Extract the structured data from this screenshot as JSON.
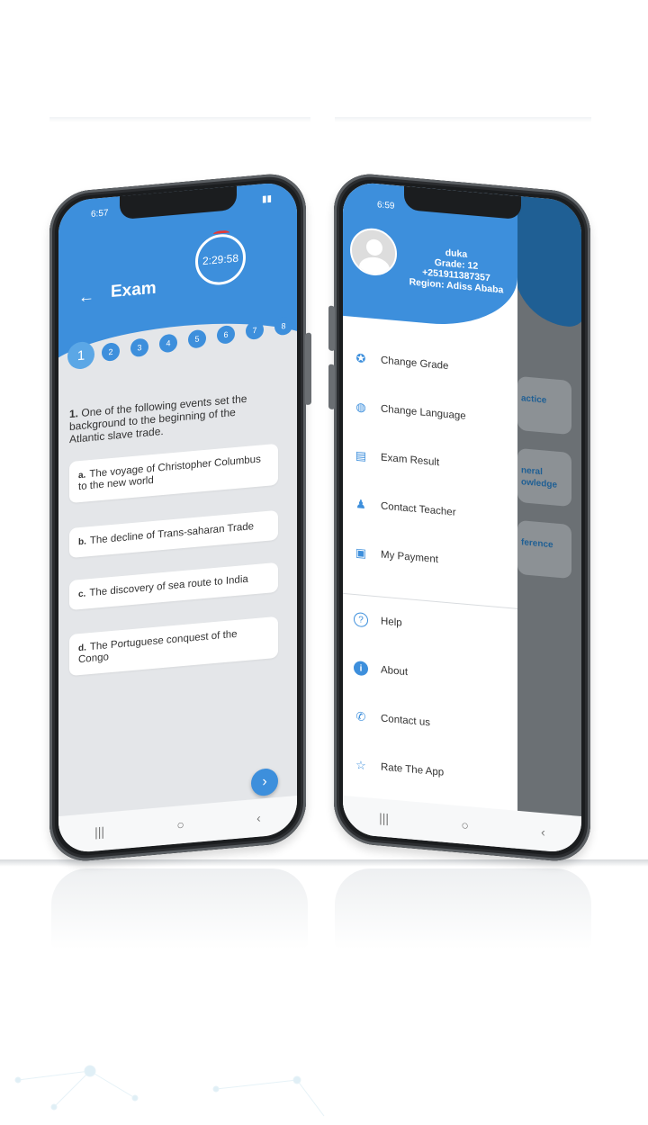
{
  "left_phone": {
    "status_time": "6:57",
    "title": "Exam",
    "timer": "2:29:58",
    "question_numbers": [
      "1",
      "2",
      "3",
      "4",
      "5",
      "6",
      "7",
      "8"
    ],
    "question": {
      "number": "1.",
      "text": "One of the following events set the background to the beginning of the Atlantic slave trade."
    },
    "options": [
      {
        "letter": "a.",
        "text": "The voyage of Christopher Columbus to the new world"
      },
      {
        "letter": "b.",
        "text": "The decline of Trans-saharan Trade"
      },
      {
        "letter": "c.",
        "text": "The discovery of sea route to India"
      },
      {
        "letter": "d.",
        "text": "The Portuguese conquest of the Congo"
      }
    ],
    "next_glyph": "›",
    "nav": {
      "recents": "|||",
      "home": "○",
      "back": "‹"
    }
  },
  "right_phone": {
    "status_time": "6:59",
    "user": {
      "name": "duka",
      "grade": "Grade: 12",
      "phone": "+251911387357",
      "region": "Region: Adiss Ababa"
    },
    "menu": [
      {
        "icon": "award-icon",
        "glyph": "✪",
        "label": "Change Grade"
      },
      {
        "icon": "globe-icon",
        "glyph": "◍",
        "label": "Change Language"
      },
      {
        "icon": "document-icon",
        "glyph": "▤",
        "label": "Exam Result"
      },
      {
        "icon": "teacher-icon",
        "glyph": "♟",
        "label": "Contact Teacher"
      },
      {
        "icon": "payment-icon",
        "glyph": "▣",
        "label": "My Payment"
      }
    ],
    "secondary_menu": [
      {
        "icon": "help-icon",
        "glyph": "?",
        "label": "Help"
      },
      {
        "icon": "info-icon",
        "glyph": "i",
        "label": "About"
      },
      {
        "icon": "phone-icon",
        "glyph": "✆",
        "label": "Contact us"
      },
      {
        "icon": "star-icon",
        "glyph": "☆",
        "label": "Rate The App"
      }
    ],
    "background_cards": [
      "actice",
      "neral\nowledge",
      "ference"
    ],
    "nav": {
      "recents": "|||",
      "home": "○",
      "back": "‹"
    }
  },
  "colors": {
    "primary": "#3d8fdc",
    "screen_bg": "#e4e6e9",
    "frame": "#1b1d1f"
  }
}
